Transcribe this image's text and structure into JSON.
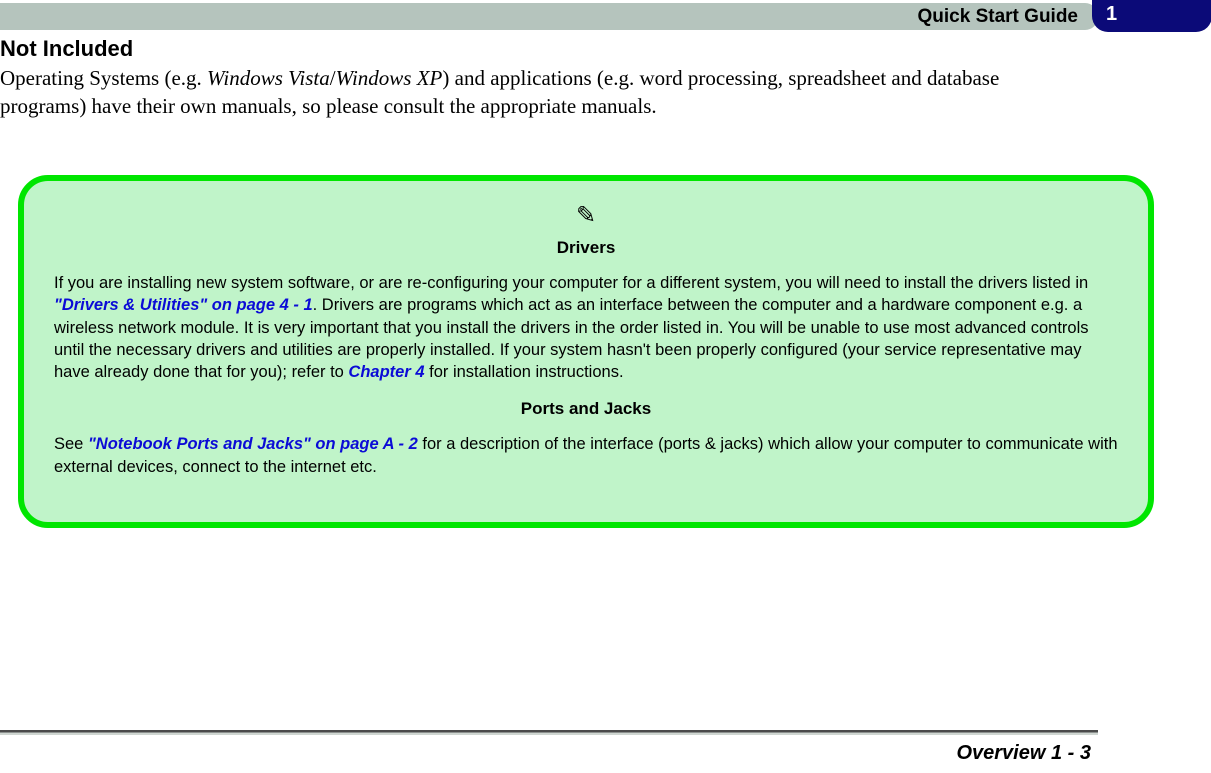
{
  "header": {
    "title": "Quick Start Guide",
    "chapter_number": "1"
  },
  "section": {
    "heading": "Not Included",
    "body_before_italics": "Operating Systems (e.g. ",
    "italic1": "Windows Vista",
    "slash": "/",
    "italic2": "Windows XP",
    "body_after_italics": ") and applications (e.g. word processing, spreadsheet and database programs) have their own manuals, so please consult the appropriate manuals."
  },
  "callout": {
    "heading1": "Drivers",
    "para1_part1": "If you are installing new system software, or are re-configuring your computer for a different system, you will need to install the drivers listed in ",
    "link1": "\"Drivers & Utilities\" on page 4 - 1",
    "para1_part2": ". Drivers are programs which act as an interface between the computer and a hardware component e.g. a wireless network module. It is very important that you install the drivers in the order listed in. You will be unable to use most advanced controls until the necessary drivers and utilities are properly installed. If your system hasn't been properly configured (your service representative may have already done that for you); refer to ",
    "link2": "Chapter 4",
    "para1_part3": " for installation instructions.",
    "heading2": "Ports and Jacks",
    "para2_part1": "See ",
    "link3": "\"Notebook Ports and Jacks\" on page A - 2",
    "para2_part2": " for a description of the interface (ports & jacks) which allow your computer to communicate with external devices, connect to the internet etc."
  },
  "footer": {
    "text": "Overview 1 - 3"
  }
}
